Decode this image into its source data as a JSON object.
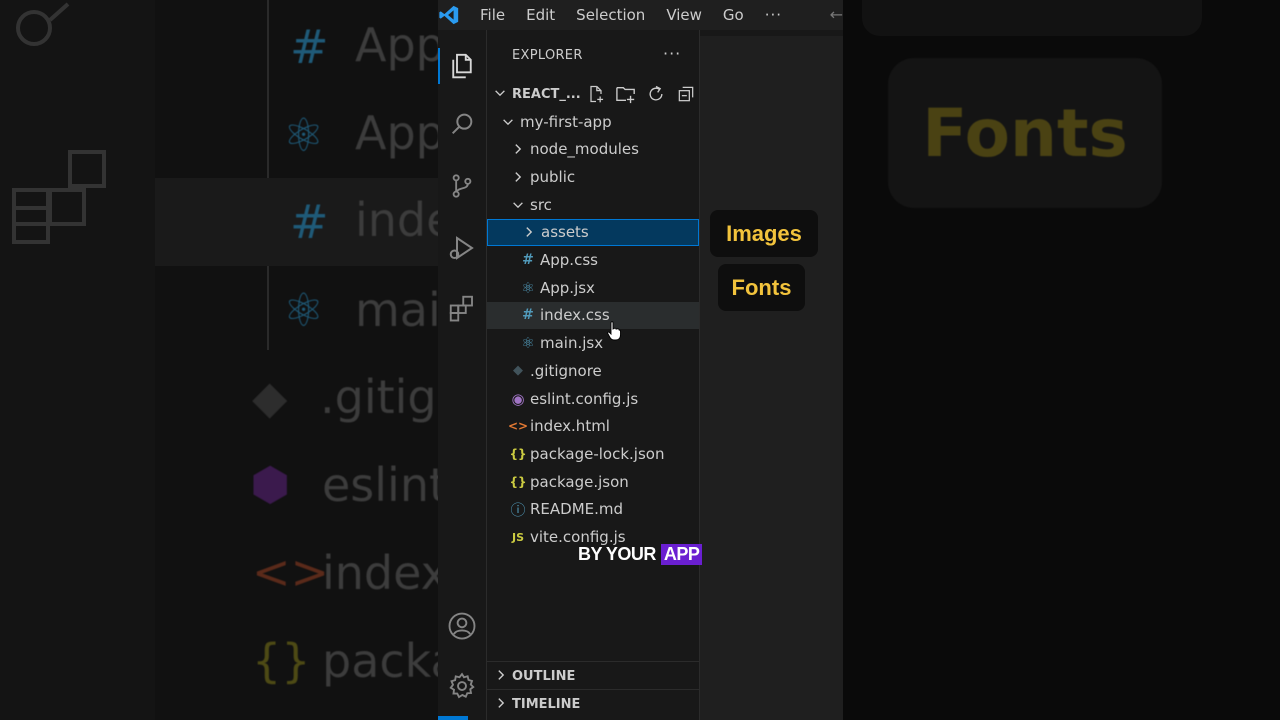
{
  "background": {
    "left_items": [
      "App",
      "App",
      "inde",
      "mai",
      ".gitig",
      "eslint",
      "index",
      "packa"
    ],
    "right_label": "Fonts"
  },
  "titlebar": {
    "menu": [
      "File",
      "Edit",
      "Selection",
      "View",
      "Go"
    ],
    "more": "···"
  },
  "activitybar": {
    "items": [
      "files-icon",
      "search-icon",
      "source-control-icon",
      "run-debug-icon",
      "extensions-icon"
    ],
    "bottom": [
      "account-icon",
      "settings-gear-icon"
    ]
  },
  "explorer": {
    "title": "EXPLORER",
    "more": "···",
    "root_label": "REACT_...",
    "tree": [
      {
        "label": "my-first-app",
        "type": "folder-open"
      },
      {
        "label": "node_modules",
        "type": "folder"
      },
      {
        "label": "public",
        "type": "folder"
      },
      {
        "label": "src",
        "type": "folder-open"
      },
      {
        "label": "assets",
        "type": "folder",
        "state": "selected"
      },
      {
        "label": "App.css",
        "type": "css"
      },
      {
        "label": "App.jsx",
        "type": "react"
      },
      {
        "label": "index.css",
        "type": "css",
        "state": "hover"
      },
      {
        "label": "main.jsx",
        "type": "react"
      },
      {
        "label": ".gitignore",
        "type": "git"
      },
      {
        "label": "eslint.config.js",
        "type": "eslint"
      },
      {
        "label": "index.html",
        "type": "html"
      },
      {
        "label": "package-lock.json",
        "type": "json"
      },
      {
        "label": "package.json",
        "type": "json"
      },
      {
        "label": "README.md",
        "type": "info"
      },
      {
        "label": "vite.config.js",
        "type": "js"
      }
    ],
    "sections": [
      "OUTLINE",
      "TIMELINE"
    ]
  },
  "overlay": {
    "bubbles": [
      "Images",
      "Fonts"
    ],
    "caption_plain": "BY YOUR",
    "caption_highlight": "APP",
    "colors": {
      "bubble_text": "#f2c33c",
      "caption_highlight": "#6a1fd1"
    }
  }
}
